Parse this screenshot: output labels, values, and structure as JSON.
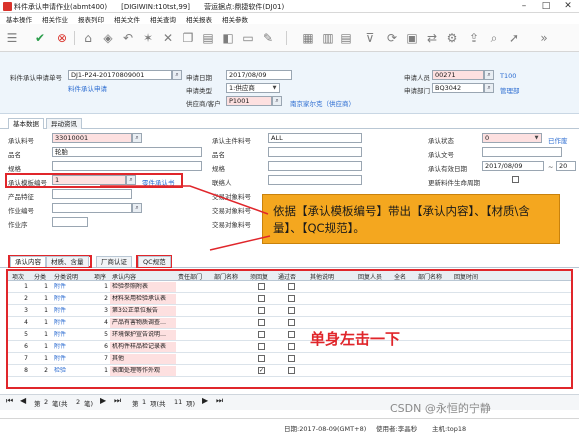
{
  "window": {
    "title": "料件承认申请作业(abmt400)　　[DIGIWIN:t10tst,99]　　营运据点:鼎捷软件(DJ01)"
  },
  "menu": [
    "基本操作",
    "相关作业",
    "报表列印",
    "相关文件",
    "相关查询",
    "相关报表",
    "相关参数"
  ],
  "toolbar_icons": [
    "list-icon",
    "confirm-icon",
    "cancel-icon",
    "home-icon",
    "bookmark-icon",
    "back-icon",
    "star-icon",
    "close-icon",
    "copy-icon",
    "print-icon",
    "paste-icon",
    "doc-icon",
    "filter-icon",
    "refresh-icon",
    "search-icon",
    "settings-icon",
    "export-icon",
    "attach-icon",
    "forward-icon",
    "more-icon"
  ],
  "header": {
    "doc_no_label": "料件承认申请单号",
    "doc_no": "DJ1-P24-20170809001",
    "doc_no_desc": "料件承认申请",
    "date_label": "申请日期",
    "date": "2017/08/09",
    "type_label": "申请类型",
    "type": "1:供应商",
    "supplier_label": "供应商/客户",
    "supplier": "P1001",
    "supplier_name": "南京家尔克（供应商）",
    "person_label": "申请人员",
    "person": "00271",
    "person_name": "T100",
    "dept_label": "申请部门",
    "dept": "BQ3042",
    "dept_name": "管理部"
  },
  "tabs_top": [
    "基本数据",
    "异动资讯"
  ],
  "form": {
    "item_label": "承认料号",
    "item": "33010001",
    "name_label": "品名",
    "name": "轮胎",
    "spec_label": "规格",
    "tpl_label": "承认模板编号",
    "tpl": "1",
    "tpl_desc": "零件承认书",
    "prod_label": "产品特征",
    "op_label": "作业编号",
    "seq_label": "作业序",
    "main_item_label": "承认主件料号",
    "main_item": "ALL",
    "name2_label": "品名",
    "spec2_label": "规格",
    "contact_label": "联络人",
    "trans1_label": "交易对象料号",
    "trans2_label": "交易对象料号",
    "trans3_label": "交易对象料号",
    "status_label": "承认状态",
    "status": "0",
    "status_desc": "已作废",
    "docno_label": "承认文号",
    "eff_label": "承认有效日期",
    "eff_from": "2017/08/09",
    "eff_sep": "~",
    "eff_to": "20",
    "update_label": "更新料件生命周期"
  },
  "callout": "依据【承认模板编号】带出【承认内容】、【材质\\含量】、【QC规范】。",
  "tabs_detail": [
    "承认内容",
    "材质、含量",
    "厂商认证",
    "QC规范"
  ],
  "grid": {
    "headers": [
      "项次",
      "分类",
      "分类说明",
      "项序",
      "承认内容",
      "责任部门",
      "部门名称",
      "须回复",
      "通过否",
      "其他说明",
      "回复人员",
      "全名",
      "部门名称",
      "回复时间"
    ],
    "rows": [
      {
        "seq": "1",
        "cat": "1",
        "cat_desc": "附件",
        "no": "1",
        "content": "检验参照附表",
        "reply": false,
        "pass": false
      },
      {
        "seq": "2",
        "cat": "1",
        "cat_desc": "附件",
        "no": "2",
        "content": "材料采用检验承认表",
        "reply": false,
        "pass": false
      },
      {
        "seq": "3",
        "cat": "1",
        "cat_desc": "附件",
        "no": "3",
        "content": "第3公正单位报告",
        "reply": false,
        "pass": false
      },
      {
        "seq": "4",
        "cat": "1",
        "cat_desc": "附件",
        "no": "4",
        "content": "产品有害物质调查…",
        "reply": false,
        "pass": false
      },
      {
        "seq": "5",
        "cat": "1",
        "cat_desc": "附件",
        "no": "5",
        "content": "环境保护宣告说明…",
        "reply": false,
        "pass": false
      },
      {
        "seq": "6",
        "cat": "1",
        "cat_desc": "附件",
        "no": "6",
        "content": "机构件样品检记录表",
        "reply": false,
        "pass": false
      },
      {
        "seq": "7",
        "cat": "1",
        "cat_desc": "附件",
        "no": "7",
        "content": "其他",
        "reply": false,
        "pass": false
      },
      {
        "seq": "8",
        "cat": "2",
        "cat_desc": "检验",
        "no": "1",
        "content": "表面处理等作外观",
        "reply": true,
        "pass": false
      }
    ]
  },
  "click_note": "单身左击一下",
  "pager": {
    "first": "第",
    "page": "2",
    "of": "笔(共",
    "total": "2",
    "unit": "笔)",
    "item": "第",
    "item_no": "1",
    "item_of": "项(共",
    "item_total": "11",
    "item_unit": "项)"
  },
  "status": {
    "date": "日期:2017-08-09(GMT+8)",
    "user": "使用者:李晶秒",
    "host": "主机:top18"
  },
  "watermark": "CSDN @永恒的宁静"
}
